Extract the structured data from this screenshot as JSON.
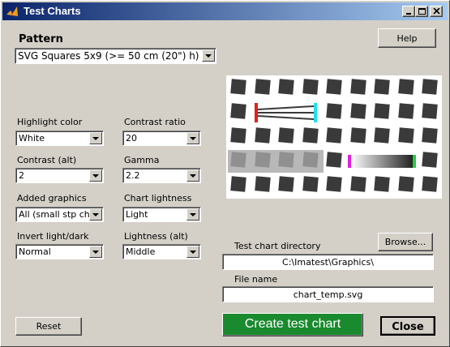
{
  "window": {
    "title": "Test Charts"
  },
  "pattern": {
    "label": "Pattern",
    "value": "SVG Squares 5x9 (>= 50 cm (20\") h)"
  },
  "buttons": {
    "help": "Help",
    "browse": "Browse...",
    "reset": "Reset",
    "create": "Create test chart",
    "close": "Close"
  },
  "options": {
    "highlight_color": {
      "label": "Highlight color",
      "value": "White"
    },
    "contrast_ratio": {
      "label": "Contrast ratio",
      "value": "20"
    },
    "contrast_alt": {
      "label": "Contrast (alt)",
      "value": "2"
    },
    "gamma": {
      "label": "Gamma",
      "value": "2.2"
    },
    "added_graphics": {
      "label": "Added graphics",
      "value": "All (small stp ch)"
    },
    "chart_lightness": {
      "label": "Chart lightness",
      "value": "Light"
    },
    "invert": {
      "label": "Invert light/dark",
      "value": "Normal"
    },
    "lightness_alt": {
      "label": "Lightness (alt)",
      "value": "Middle"
    }
  },
  "directory": {
    "label": "Test chart directory",
    "value": "C:\\Imatest\\Graphics\\"
  },
  "file": {
    "label": "File name",
    "value": "chart_temp.svg"
  },
  "colors": {
    "title_gradient_start": "#0a246a",
    "create_button_bg": "#1a8a2e",
    "square_dark": "#3a3a3a",
    "square_light": "#909090",
    "marker_red": "#e02020",
    "marker_cyan": "#20e0f0",
    "marker_magenta": "#e020e0",
    "marker_green": "#20d040"
  }
}
